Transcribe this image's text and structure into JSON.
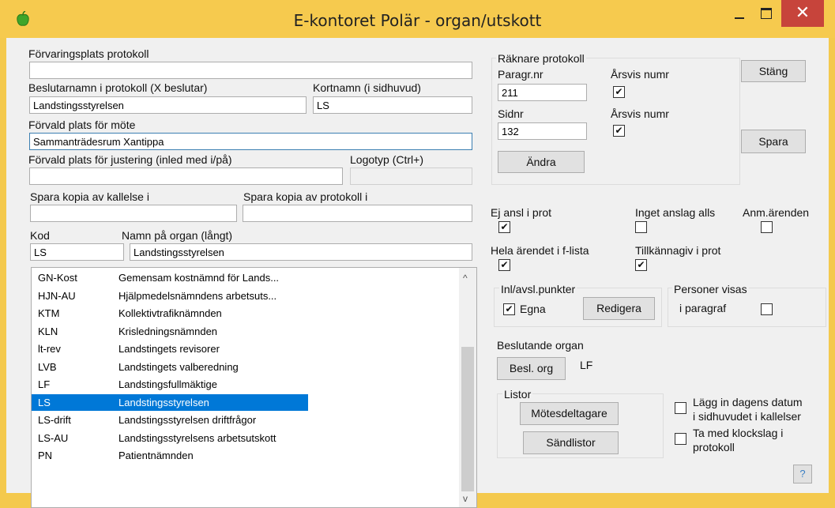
{
  "window": {
    "title": "E-kontoret Polär - organ/utskott",
    "close_glyph": "✕"
  },
  "fields": {
    "forvaringsplats_label": "Förvaringsplats protokoll",
    "forvaringsplats_value": "",
    "beslutarnamn_label": "Beslutarnamn i protokoll (X beslutar)",
    "beslutarnamn_value": "Landstingsstyrelsen",
    "kortnamn_label": "Kortnamn (i sidhuvud)",
    "kortnamn_value": "LS",
    "forvald_plats_label": "Förvald plats för möte",
    "forvald_plats_value": "Sammanträdesrum Xantippa",
    "justering_label": "Förvald plats för justering (inled med i/på)",
    "justering_value": "",
    "logotyp_label": "Logotyp (Ctrl+)",
    "logotyp_value": "",
    "kopia_kallelse_label": "Spara kopia av kallelse i",
    "kopia_kallelse_value": "",
    "kopia_protokoll_label": "Spara kopia av protokoll i",
    "kopia_protokoll_value": "",
    "kod_label": "Kod",
    "kod_value": "LS",
    "namn_label": "Namn på organ (långt)",
    "namn_value": "Landstingsstyrelsen"
  },
  "list": {
    "items": [
      {
        "code": "GN-Kost",
        "name": "Gemensam kostnämnd för Lands..."
      },
      {
        "code": "HJN-AU",
        "name": "Hjälpmedelsnämndens arbetsuts..."
      },
      {
        "code": "KTM",
        "name": "Kollektivtrafiknämnden"
      },
      {
        "code": "KLN",
        "name": "Krisledningsnämnden"
      },
      {
        "code": "lt-rev",
        "name": "Landstingets revisorer"
      },
      {
        "code": "LVB",
        "name": "Landstingets valberedning"
      },
      {
        "code": "LF",
        "name": "Landstingsfullmäktige"
      },
      {
        "code": "LS",
        "name": "Landstingsstyrelsen"
      },
      {
        "code": "LS-drift",
        "name": "Landstingsstyrelsen driftfrågor"
      },
      {
        "code": "LS-AU",
        "name": "Landstingsstyrelsens arbetsutskott"
      },
      {
        "code": "PN",
        "name": "Patientnämnden"
      }
    ],
    "selected_index": 7,
    "scroll_up": "^",
    "scroll_down": "v"
  },
  "counter": {
    "group_label": "Räknare protokoll",
    "paragr_label": "Paragr.nr",
    "paragr_value": "211",
    "arsvis1_label": "Årsvis numr",
    "arsvis1_checked": true,
    "sidnr_label": "Sidnr",
    "sidnr_value": "132",
    "arsvis2_label": "Årsvis numr",
    "arsvis2_checked": true,
    "andra_button": "Ändra"
  },
  "buttons": {
    "stang": "Stäng",
    "spara": "Spara",
    "help": "?"
  },
  "options": {
    "ej_ansl_label": "Ej ansl i prot",
    "ej_ansl_checked": true,
    "inget_anslag_label": "Inget anslag alls",
    "inget_anslag_checked": false,
    "anm_arenden_label": "Anm.ärenden",
    "anm_arenden_checked": false,
    "hela_arendet_label": "Hela ärendet i f-lista",
    "hela_arendet_checked": true,
    "tillkannagiv_label": "Tillkännagiv i prot",
    "tillkannagiv_checked": true
  },
  "inl": {
    "group_label": "Inl/avsl.punkter",
    "egna_label": "Egna",
    "egna_checked": true,
    "redigera_button": "Redigera"
  },
  "personer": {
    "group_label": "Personer visas",
    "paragraf_label": "i paragraf",
    "paragraf_checked": false
  },
  "beslutande": {
    "label": "Beslutande organ",
    "button": "Besl. org",
    "value": "LF"
  },
  "listor": {
    "group_label": "Listor",
    "motesdeltagare_button": "Mötesdeltagare",
    "sandlistor_button": "Sändlistor"
  },
  "extra": {
    "datum_label_1": "Lägg in dagens datum",
    "datum_label_2": "i sidhuvudet i kallelser",
    "datum_checked": false,
    "klockslag_label_1": "Ta med klockslag i",
    "klockslag_label_2": "protokoll",
    "klockslag_checked": false
  },
  "colors": {
    "titlebar": "#f6ca4e",
    "close": "#c7443b",
    "selection": "#0078d7",
    "client": "#f0f0f0"
  }
}
